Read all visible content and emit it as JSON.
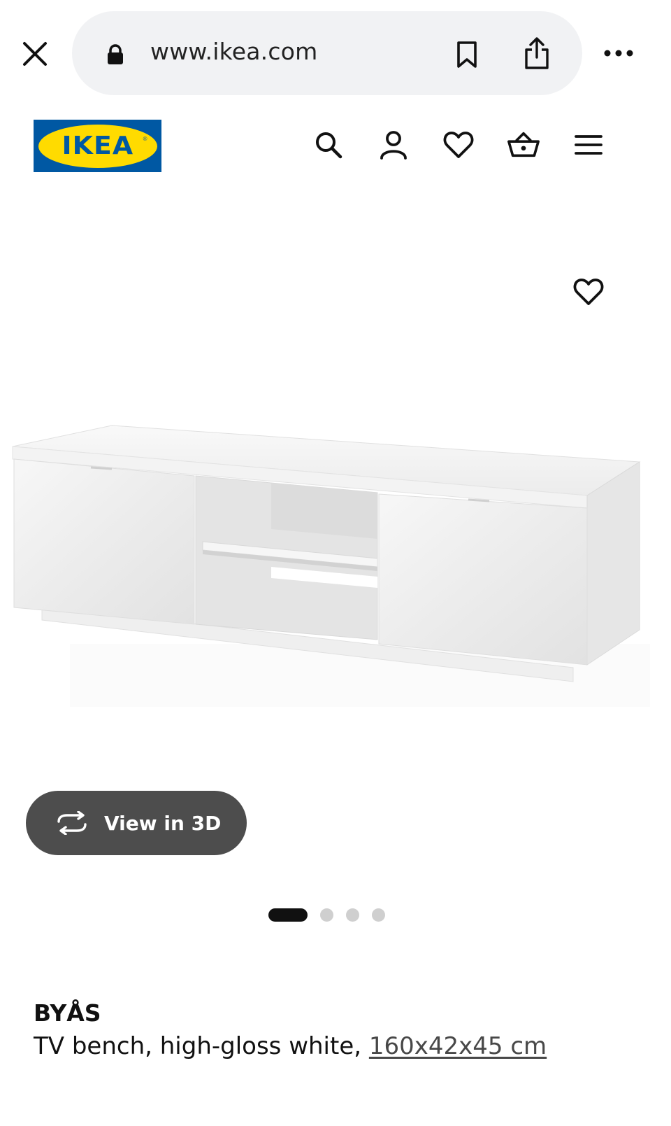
{
  "browser": {
    "url": "www.ikea.com"
  },
  "header": {
    "logo_text": "IKEA",
    "logo_reg": "®",
    "icons": [
      "search-icon",
      "account-icon",
      "heart-icon",
      "basket-icon",
      "menu-icon"
    ]
  },
  "gallery": {
    "view_3d_label": "View in 3D",
    "slide_count": 4,
    "active_slide": 1
  },
  "product": {
    "name": "BYÅS",
    "description": "TV bench, high-gloss white, ",
    "dimensions": "160x42x45 cm"
  },
  "colors": {
    "ikea_blue": "#0058a3",
    "ikea_yellow": "#ffdb00",
    "button_dark": "#4d4d4d"
  }
}
